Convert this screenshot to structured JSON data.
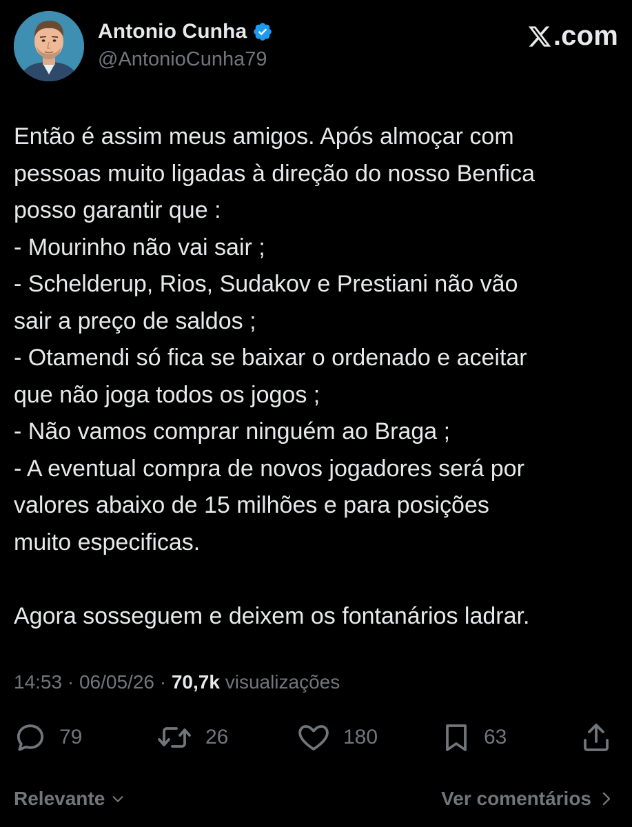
{
  "author": {
    "display_name": "Antonio Cunha",
    "handle": "@AntonioCunha79",
    "verified_badge_color": "#1d9bf0",
    "avatar_icon": "avatar-illustration"
  },
  "site": {
    "logo_icon": "x-logo",
    "suffix": ".com"
  },
  "post": {
    "lines": [
      "Então é assim meus amigos. Após almoçar com",
      "pessoas muito ligadas à direção do nosso Benfica",
      "posso garantir que :",
      "- Mourinho não vai sair ;",
      "- Schelderup, Rios, Sudakov e Prestiani não vão",
      "sair a preço de saldos ;",
      "- Otamendi só fica se baixar o ordenado e aceitar",
      "que não joga todos os jogos ;",
      "- Não vamos comprar ninguém ao Braga ;",
      "- A eventual compra de novos jogadores será por",
      "valores abaixo de 15 milhões e para posições",
      "muito especificas.",
      "",
      "Agora sosseguem e deixem os fontanários ladrar."
    ]
  },
  "meta": {
    "time": "14:53",
    "separator": " · ",
    "date": "06/05/26",
    "views_count": "70,7k",
    "views_label": " visualizações"
  },
  "actions": {
    "replies": "79",
    "reposts": "26",
    "likes": "180",
    "bookmarks": "63"
  },
  "footer": {
    "sort_label": "Relevante",
    "comments_label": "Ver comentários"
  },
  "colors": {
    "background": "#000000",
    "text": "#e7e9ea",
    "muted": "#71767b",
    "accent": "#1d9bf0"
  }
}
